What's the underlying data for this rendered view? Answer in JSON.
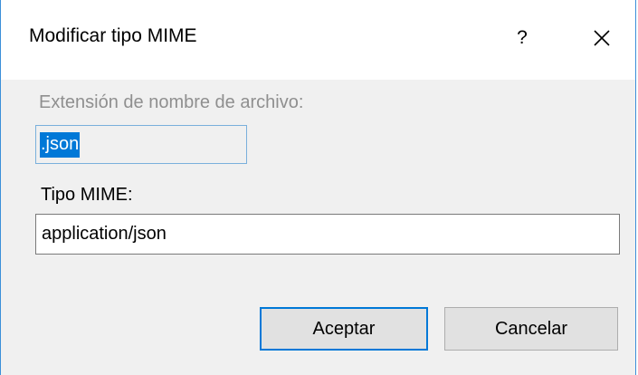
{
  "dialog": {
    "title": "Modificar tipo MIME",
    "help_label": "?",
    "close_icon": "close-icon"
  },
  "extension": {
    "label": "Extensión de nombre de archivo:",
    "value": ".json",
    "disabled": true
  },
  "mime": {
    "label": "Tipo MIME:",
    "value": "application/json"
  },
  "buttons": {
    "ok_label": "Aceptar",
    "cancel_label": "Cancelar"
  },
  "colors": {
    "accent": "#0078d7",
    "window_border": "#3b8fd9",
    "dialog_bg": "#f0f0f0",
    "disabled_text": "#8f8f8f"
  }
}
